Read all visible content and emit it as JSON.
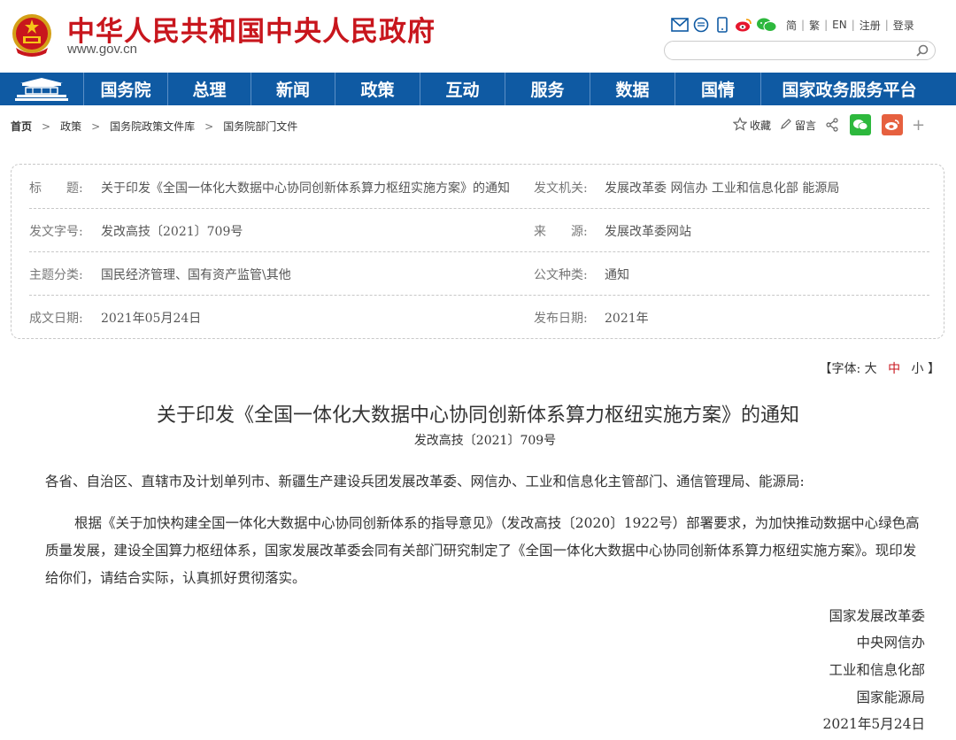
{
  "header": {
    "site_title": "中华人民共和国中央人民政府",
    "site_url": "www.gov.cn",
    "lang_links": [
      "简",
      "繁",
      "EN",
      "注册",
      "登录"
    ],
    "colors": {
      "brand_red": "#c8161d",
      "nav_blue": "#0f5aa3"
    }
  },
  "nav": {
    "items": [
      "国务院",
      "总理",
      "新闻",
      "政策",
      "互动",
      "服务",
      "数据",
      "国情",
      "国家政务服务平台"
    ]
  },
  "breadcrumb": [
    "首页",
    "政策",
    "国务院政策文件库",
    "国务院部门文件"
  ],
  "share": {
    "collect": "收藏",
    "comment": "留言"
  },
  "meta": {
    "title_label": "标　　题:",
    "title_value": "关于印发《全国一体化大数据中心协同创新体系算力枢纽实施方案》的通知",
    "issuer_label": "发文机关:",
    "issuer_value": "发展改革委  网信办  工业和信息化部  能源局",
    "docno_label": "发文字号:",
    "docno_value": "发改高技〔2021〕709号",
    "source_label": "来　　源:",
    "source_value": "发展改革委网站",
    "category_label": "主题分类:",
    "category_value": "国民经济管理、国有资产监管\\其他",
    "type_label": "公文种类:",
    "type_value": "通知",
    "created_label": "成文日期:",
    "created_value": "2021年05月24日",
    "published_label": "发布日期:",
    "published_value": "2021年"
  },
  "font_size": {
    "prefix": "【字体:",
    "large": "大",
    "medium": "中",
    "small": "小",
    "suffix": "】"
  },
  "article": {
    "title": "关于印发《全国一体化大数据中心协同创新体系算力枢纽实施方案》的通知",
    "docno": "发改高技〔2021〕709号",
    "salutation": "各省、自治区、直辖市及计划单列市、新疆生产建设兵团发展改革委、网信办、工业和信息化主管部门、通信管理局、能源局:",
    "body": "根据《关于加快构建全国一体化大数据中心协同创新体系的指导意见》（发改高技〔2020〕1922号）部署要求，为加快推动数据中心绿色高质量发展，建设全国算力枢纽体系，国家发展改革委会同有关部门研究制定了《全国一体化大数据中心协同创新体系算力枢纽实施方案》。现印发给你们，请结合实际，认真抓好贯彻落实。",
    "signatures": [
      "国家发展改革委",
      "中央网信办",
      "工业和信息化部",
      "国家能源局"
    ],
    "date": "2021年5月24日"
  }
}
